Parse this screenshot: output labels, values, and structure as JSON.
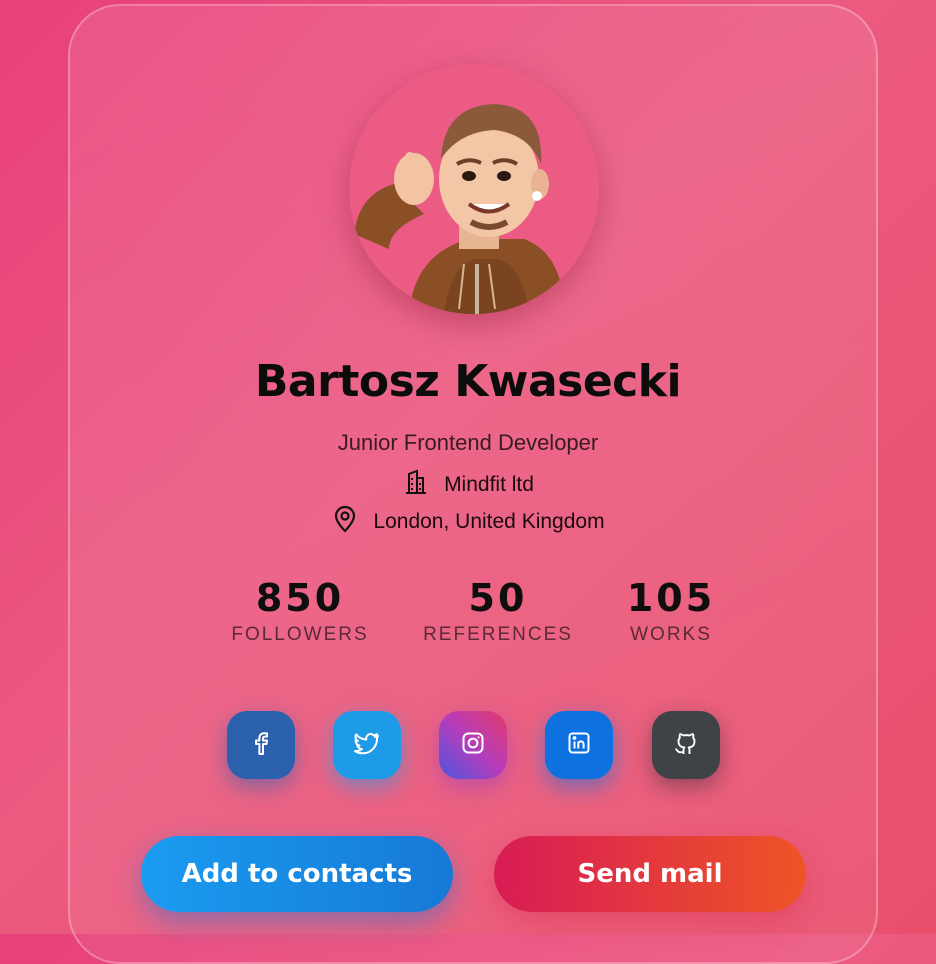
{
  "profile": {
    "name": "Bartosz Kwasecki",
    "title": "Junior Frontend Developer",
    "company": "Mindfit ltd",
    "location": "London, United Kingdom"
  },
  "stats": [
    {
      "value": "850",
      "label": "FOLLOWERS"
    },
    {
      "value": "50",
      "label": "REFERENCES"
    },
    {
      "value": "105",
      "label": "WORKS"
    }
  ],
  "social": [
    "facebook-icon",
    "twitter-icon",
    "instagram-icon",
    "linkedin-icon",
    "github-icon"
  ],
  "actions": {
    "add_label": "Add to contacts",
    "mail_label": "Send mail"
  },
  "icons": {
    "company": "building-icon",
    "location": "map-pin-icon"
  },
  "colors": {
    "background": "#e8457c",
    "facebook": "#2b60ad",
    "twitter": "#1d9be6",
    "linkedin": "#0d72e0",
    "github": "#3f4348",
    "add_button": "#1a8ce8",
    "mail_button": "#e23a40"
  }
}
